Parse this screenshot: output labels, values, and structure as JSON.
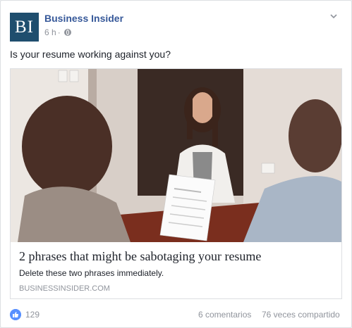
{
  "post": {
    "page_name": "Business Insider",
    "logo_text": "BI",
    "time": "6 h",
    "separator": "·",
    "privacy_icon": "globe-icon",
    "menu_icon": "chevron-down-icon",
    "text": "Is your resume working against you?"
  },
  "link": {
    "image_icon": "interview-photo",
    "title": "2 phrases that might be sabotaging your resume",
    "description": "Delete these two phrases immediately.",
    "domain": "BUSINESSINSIDER.COM"
  },
  "footer": {
    "like_icon": "thumbs-up-icon",
    "likes": "129",
    "comments": "6 comentarios",
    "shares": "76 veces compartido"
  },
  "colors": {
    "brand_blue": "#365899",
    "logo_bg": "#1f4e6e",
    "meta_gray": "#90949c",
    "like_blue": "#5890ff"
  }
}
